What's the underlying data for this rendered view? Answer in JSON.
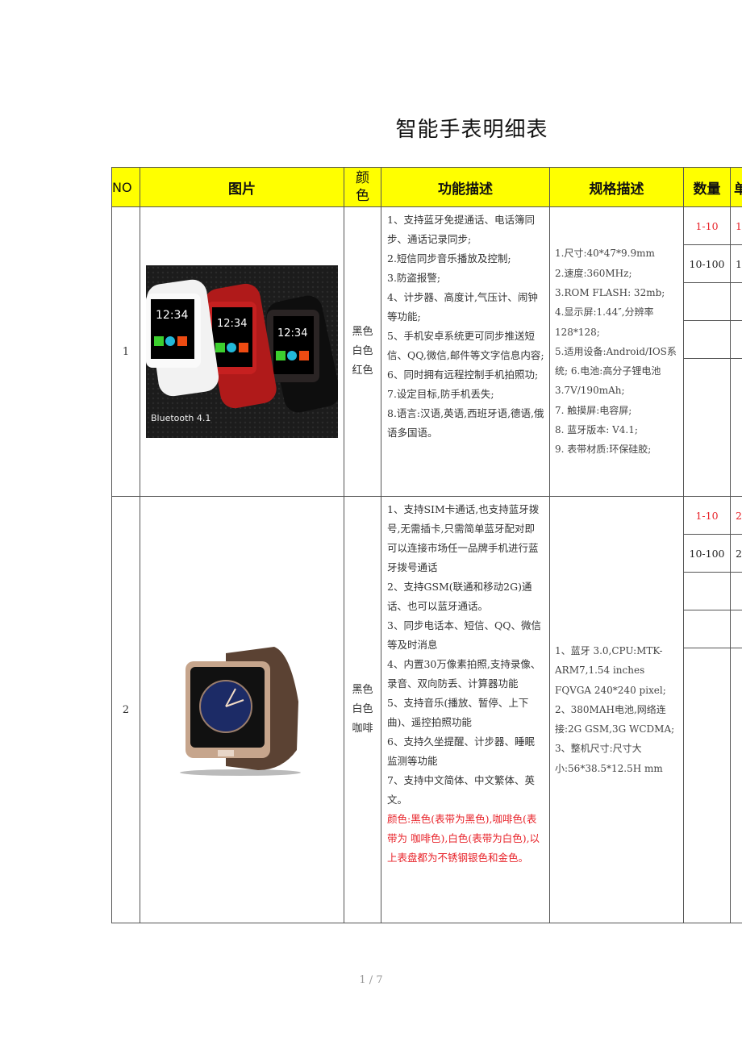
{
  "title": "智能手表明细表",
  "headers": {
    "no": "NO",
    "picture": "图片",
    "color": "颜\n色",
    "features": "功能描述",
    "specs": "规格描述",
    "quantity": "数量",
    "price_partial": "单"
  },
  "products": [
    {
      "no": "1",
      "image_label": "Bluetooth 4.1",
      "image_screen_time": "12:34",
      "colors": [
        "黑色",
        "白色",
        "红色"
      ],
      "features": [
        "1、支持蓝牙免提通话、电话簿同步、通话记录同步;",
        "2.短信同步音乐播放及控制;",
        "3.防盗报警;",
        "4、计步器、高度计,气压计、闹钟等功能;",
        "5、手机安卓系统更可同步推送短信、QQ,微信,邮件等文字信息内容;",
        "6、同时拥有远程控制手机拍照功;",
        "7.设定目标,防手机丢失;",
        "8.语言:汉语,英语,西班牙语,德语,俄语多国语。"
      ],
      "features_note": "",
      "specs": [
        "1.尺寸:40*47*9.9mm",
        "2.速度:360MHz;",
        "3.ROM FLASH: 32mb;",
        "4.显示屏:1.44″,分辨率128*128;",
        "5.适用设备:Android/IOS系统; 6.电池:高分子锂电池3.7V/190mAh;",
        "7. 触摸屏:电容屏;",
        "8. 蓝牙版本: V4.1;",
        "9. 表带材质:环保硅胶;"
      ],
      "quantity_tiers": [
        {
          "range": "1-10",
          "highlight": true,
          "price_partial": "1"
        },
        {
          "range": "10-100",
          "highlight": false,
          "price_partial": "1"
        },
        {
          "range": "",
          "highlight": false,
          "price_partial": ""
        },
        {
          "range": "",
          "highlight": false,
          "price_partial": ""
        },
        {
          "range": "",
          "highlight": false,
          "price_partial": ""
        }
      ]
    },
    {
      "no": "2",
      "image_label": "",
      "colors": [
        "黑色",
        "白色",
        "咖啡"
      ],
      "features": [
        "1、支持SIM卡通话,也支持蓝牙拨号,无需插卡,只需简单蓝牙配对即可以连接市场任一品牌手机进行蓝牙拨号通话",
        "2、支持GSM(联通和移动2G)通话、也可以蓝牙通话。",
        "3、同步电话本、短信、QQ、微信等及时消息",
        "4、内置30万像素拍照,支持录像、录音、双向防丢、计算器功能",
        "5、支持音乐(播放、暂停、上下曲)、遥控拍照功能",
        "6、支持久坐提醒、计步器、睡眠监测等功能",
        "7、支持中文简体、中文繁体、英文。"
      ],
      "features_note": "颜色:黑色(表带为黑色),咖啡色(表带为 咖啡色),白色(表带为白色),以上表盘都为不锈钢银色和金色。",
      "specs": [
        "1、蓝牙 3.0,CPU:MTK-ARM7,1.54 inches FQVGA 240*240 pixel;",
        "2、380MAH电池,网络连接:2G GSM,3G WCDMA;",
        "3、整机尺寸:尺寸大小:56*38.5*12.5H mm"
      ],
      "quantity_tiers": [
        {
          "range": "1-10",
          "highlight": true,
          "price_partial": "2"
        },
        {
          "range": "10-100",
          "highlight": false,
          "price_partial": "2"
        },
        {
          "range": "",
          "highlight": false,
          "price_partial": ""
        },
        {
          "range": "",
          "highlight": false,
          "price_partial": ""
        },
        {
          "range": "",
          "highlight": false,
          "price_partial": ""
        }
      ]
    }
  ],
  "footer": {
    "page_indicator": "1 / 7"
  },
  "colors": {
    "header_bg": "#ffff00",
    "highlight_text": "#e8232a"
  }
}
